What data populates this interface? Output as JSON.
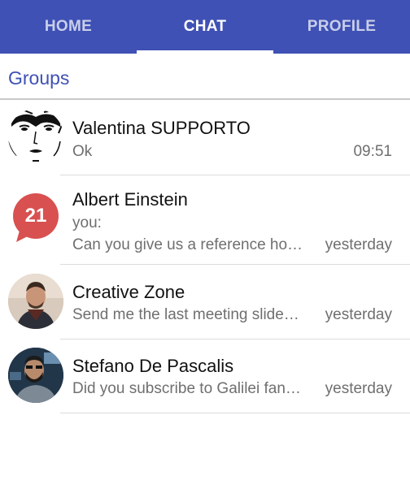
{
  "tabs": [
    {
      "label": "HOME",
      "active": false
    },
    {
      "label": "CHAT",
      "active": true
    },
    {
      "label": "PROFILE",
      "active": false
    }
  ],
  "section": {
    "title": "Groups"
  },
  "chats": [
    {
      "name": "Valentina SUPPORTO",
      "preview": "Ok",
      "time": "09:51",
      "avatar": "sketch-face-icon"
    },
    {
      "name": "Albert Einstein",
      "prefix": "you:",
      "preview": "Can you give us a reference ho…",
      "time": "yesterday",
      "avatar": "badge-21-icon",
      "badge": "21"
    },
    {
      "name": "Creative Zone",
      "preview": "Send me the last meeting slide…",
      "time": "yesterday",
      "avatar": "man-portrait-avatar"
    },
    {
      "name": "Stefano De Pascalis",
      "preview": "Did you subscribe to Galilei fan…",
      "time": "yesterday",
      "avatar": "bearded-man-avatar"
    }
  ],
  "colors": {
    "primary": "#3f51b5",
    "badge": "#d85050"
  }
}
